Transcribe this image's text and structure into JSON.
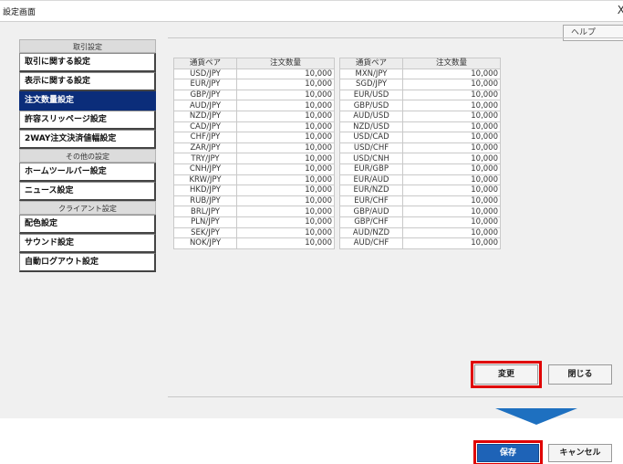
{
  "window": {
    "title": "設定画面",
    "close": "X",
    "help": "ヘルプ"
  },
  "sidebar": {
    "groups": [
      {
        "header": "取引設定",
        "items": [
          "取引に関する設定",
          "表示に関する設定",
          "注文数量設定",
          "許容スリッページ設定",
          "2WAY注文決済値幅設定"
        ]
      },
      {
        "header": "その他の設定",
        "items": [
          "ホームツールバー設定",
          "ニュース設定"
        ]
      },
      {
        "header": "クライアント設定",
        "items": [
          "配色設定",
          "サウンド設定",
          "自動ログアウト設定"
        ]
      }
    ],
    "active_item": "注文数量設定"
  },
  "table_left": {
    "headers": [
      "通貨ペア",
      "注文数量"
    ],
    "rows": [
      [
        "USD/JPY",
        "10,000"
      ],
      [
        "EUR/JPY",
        "10,000"
      ],
      [
        "GBP/JPY",
        "10,000"
      ],
      [
        "AUD/JPY",
        "10,000"
      ],
      [
        "NZD/JPY",
        "10,000"
      ],
      [
        "CAD/JPY",
        "10,000"
      ],
      [
        "CHF/JPY",
        "10,000"
      ],
      [
        "ZAR/JPY",
        "10,000"
      ],
      [
        "TRY/JPY",
        "10,000"
      ],
      [
        "CNH/JPY",
        "10,000"
      ],
      [
        "KRW/JPY",
        "10,000"
      ],
      [
        "HKD/JPY",
        "10,000"
      ],
      [
        "RUB/JPY",
        "10,000"
      ],
      [
        "BRL/JPY",
        "10,000"
      ],
      [
        "PLN/JPY",
        "10,000"
      ],
      [
        "SEK/JPY",
        "10,000"
      ],
      [
        "NOK/JPY",
        "10,000"
      ]
    ]
  },
  "table_right": {
    "headers": [
      "通貨ペア",
      "注文数量"
    ],
    "rows": [
      [
        "MXN/JPY",
        "10,000"
      ],
      [
        "SGD/JPY",
        "10,000"
      ],
      [
        "EUR/USD",
        "10,000"
      ],
      [
        "GBP/USD",
        "10,000"
      ],
      [
        "AUD/USD",
        "10,000"
      ],
      [
        "NZD/USD",
        "10,000"
      ],
      [
        "USD/CAD",
        "10,000"
      ],
      [
        "USD/CHF",
        "10,000"
      ],
      [
        "USD/CNH",
        "10,000"
      ],
      [
        "EUR/GBP",
        "10,000"
      ],
      [
        "EUR/AUD",
        "10,000"
      ],
      [
        "EUR/NZD",
        "10,000"
      ],
      [
        "EUR/CHF",
        "10,000"
      ],
      [
        "GBP/AUD",
        "10,000"
      ],
      [
        "GBP/CHF",
        "10,000"
      ],
      [
        "AUD/NZD",
        "10,000"
      ],
      [
        "AUD/CHF",
        "10,000"
      ]
    ]
  },
  "buttons": {
    "change": "変更",
    "close": "閉じる",
    "save": "保存",
    "cancel": "キャンセル"
  },
  "colors": {
    "active": "#0b2d7a",
    "highlight": "#e00000",
    "save_bg": "#1e63b7",
    "arrow": "#1e70c0"
  }
}
